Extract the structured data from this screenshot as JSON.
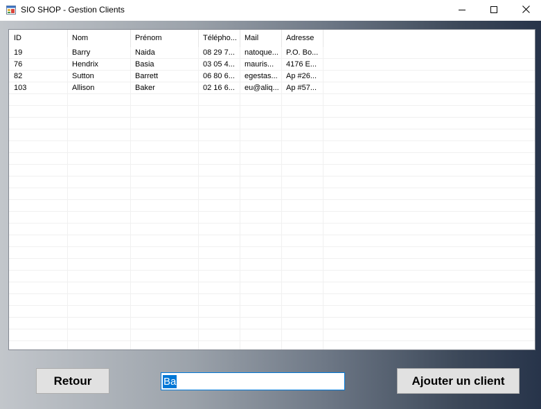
{
  "window": {
    "title": "SIO SHOP - Gestion Clients",
    "icon": "app-form-icon",
    "controls": [
      "minimize-icon",
      "maximize-icon",
      "close-icon"
    ]
  },
  "grid": {
    "columns": [
      "ID",
      "Nom",
      "Prénom",
      "Télépho...",
      "Mail",
      "Adresse"
    ],
    "rows": [
      [
        "19",
        "Barry",
        "Naida",
        "08 29 7...",
        "natoque...",
        "P.O. Bo..."
      ],
      [
        "76",
        "Hendrix",
        "Basia",
        "03 05 4...",
        "mauris...",
        "4176 E..."
      ],
      [
        "82",
        "Sutton",
        "Barrett",
        "06 80 6...",
        "egestas...",
        "Ap #26..."
      ],
      [
        "103",
        "Allison",
        "Baker",
        "02 16 6...",
        "eu@aliq...",
        "Ap #57..."
      ]
    ]
  },
  "buttons": {
    "back_label": "Retour",
    "add_label": "Ajouter un client"
  },
  "search": {
    "value": "Ba"
  },
  "colors": {
    "accent": "#0078d7",
    "button_bg": "#e1e1e1",
    "gradient_left": "#c2c6cb",
    "gradient_right": "#27344a"
  }
}
